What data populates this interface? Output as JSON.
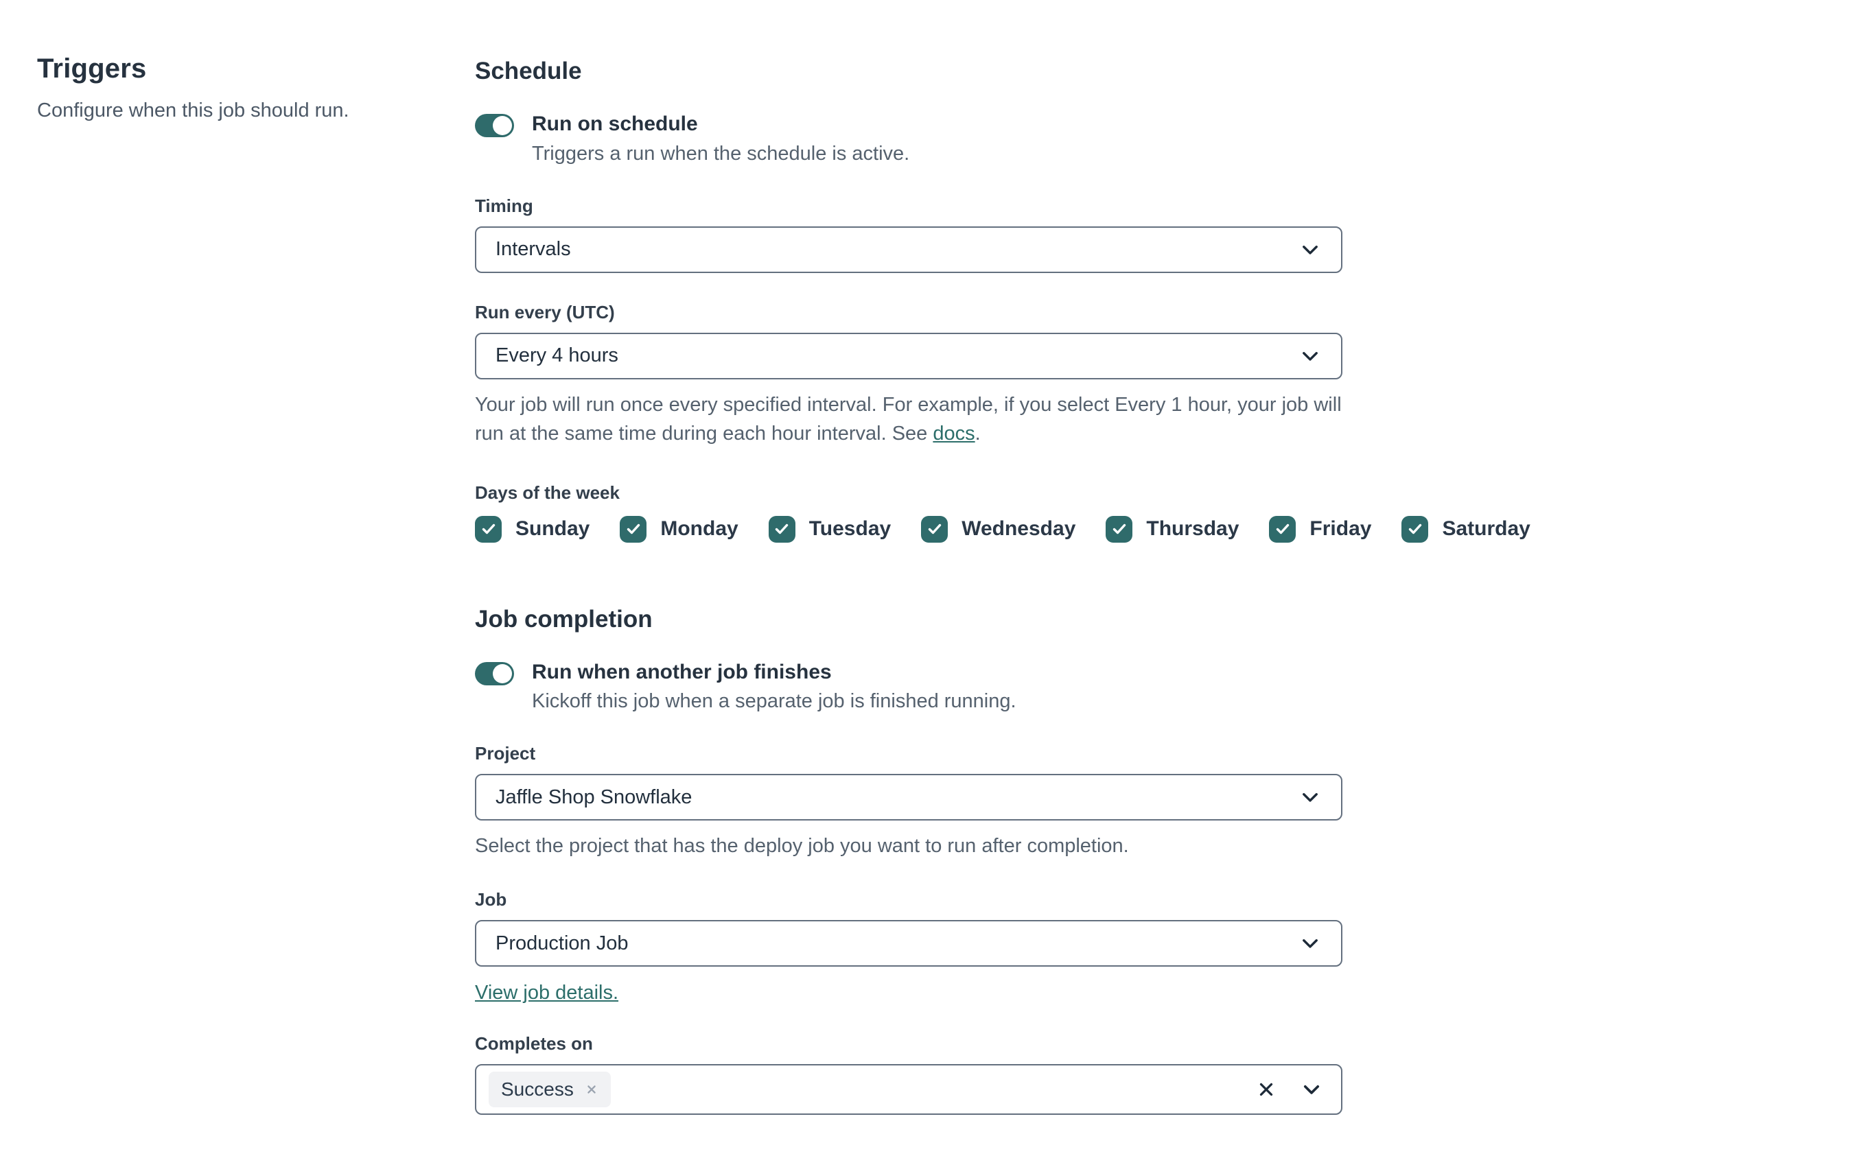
{
  "left": {
    "title": "Triggers",
    "subtitle": "Configure when this job should run."
  },
  "schedule": {
    "heading": "Schedule",
    "toggle": {
      "label": "Run on schedule",
      "description": "Triggers a run when the schedule is active.",
      "on": true
    },
    "timing": {
      "label": "Timing",
      "value": "Intervals"
    },
    "run_every": {
      "label": "Run every (UTC)",
      "value": "Every 4 hours",
      "help_before": "Your job will run once every specified interval. For example, if you select Every 1 hour, your job will run at the same time during each hour interval. See ",
      "help_link": "docs",
      "help_after": "."
    },
    "days": {
      "label": "Days of the week",
      "items": [
        {
          "label": "Sunday",
          "checked": true
        },
        {
          "label": "Monday",
          "checked": true
        },
        {
          "label": "Tuesday",
          "checked": true
        },
        {
          "label": "Wednesday",
          "checked": true
        },
        {
          "label": "Thursday",
          "checked": true
        },
        {
          "label": "Friday",
          "checked": true
        },
        {
          "label": "Saturday",
          "checked": true
        }
      ]
    }
  },
  "job_completion": {
    "heading": "Job completion",
    "toggle": {
      "label": "Run when another job finishes",
      "description": "Kickoff this job when a separate job is finished running.",
      "on": true
    },
    "project": {
      "label": "Project",
      "value": "Jaffle Shop Snowflake",
      "help": "Select the project that has the deploy job you want to run after completion."
    },
    "job": {
      "label": "Job",
      "value": "Production Job",
      "link_text": "View job details."
    },
    "completes_on": {
      "label": "Completes on",
      "tags": [
        "Success"
      ]
    }
  },
  "icons": {
    "chevron_down": "v",
    "clear": "x",
    "remove_tag": "x",
    "check": "check"
  },
  "colors": {
    "accent_teal": "#2f6b6b",
    "link_teal": "#2c6e6a",
    "heading_text": "#26323f",
    "body_text": "#222f3d",
    "muted_text": "#55616e",
    "control_border": "#64707f",
    "tag_background": "#f1f2f4",
    "page_background": "#ffffff"
  }
}
